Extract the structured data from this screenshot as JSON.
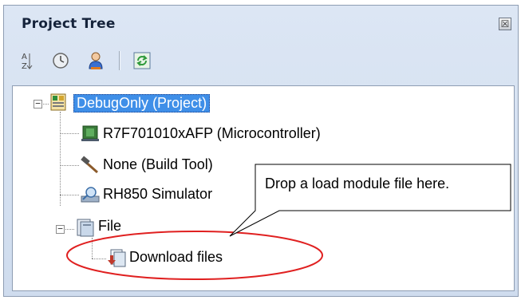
{
  "panel": {
    "title": "Project Tree",
    "close_glyph": "☒",
    "toolbar": [
      {
        "name": "sort-icon"
      },
      {
        "name": "clock-icon"
      },
      {
        "name": "person-icon"
      },
      {
        "name": "refresh-icon"
      }
    ]
  },
  "tree": {
    "root": {
      "label": "DebugOnly (Project)",
      "expander": "−"
    },
    "children": [
      {
        "label": "R7F701010xAFP (Microcontroller)",
        "icon": "microcontroller-icon"
      },
      {
        "label": "None (Build Tool)",
        "icon": "hammer-icon"
      },
      {
        "label": "RH850 Simulator",
        "icon": "simulator-icon"
      },
      {
        "label": "File",
        "icon": "file-folder-icon",
        "expander": "−"
      }
    ],
    "file_children": [
      {
        "label": "Download files",
        "icon": "download-files-icon"
      }
    ]
  },
  "callout": {
    "text": "Drop a load module file here."
  }
}
